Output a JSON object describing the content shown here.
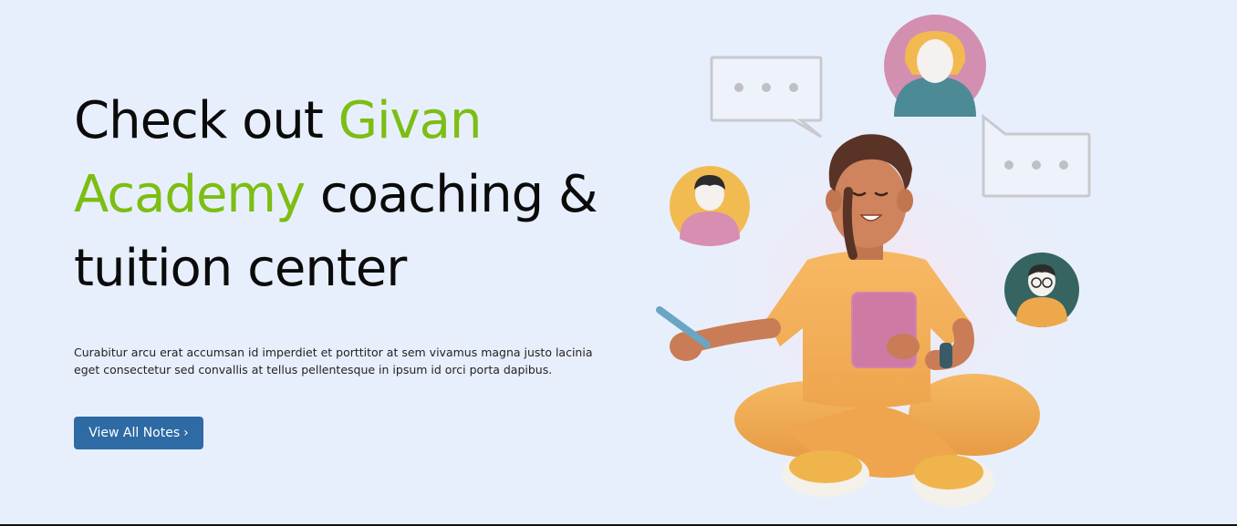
{
  "hero": {
    "headline_pre": "Check out ",
    "headline_accent": "Givan Academy",
    "headline_post": " coaching & tuition center",
    "description": "Curabitur arcu erat accumsan id imperdiet et porttitor at sem vivamus magna justo lacinia eget consectetur sed convallis at tellus pellentesque in ipsum id orci porta dapibus.",
    "cta_label": "View All Notes",
    "cta_icon": "chevron-right-icon"
  },
  "colors": {
    "background": "#e8effc",
    "accent": "#7cbe13",
    "button": "#2e6aa4",
    "text": "#0b0b0b"
  }
}
